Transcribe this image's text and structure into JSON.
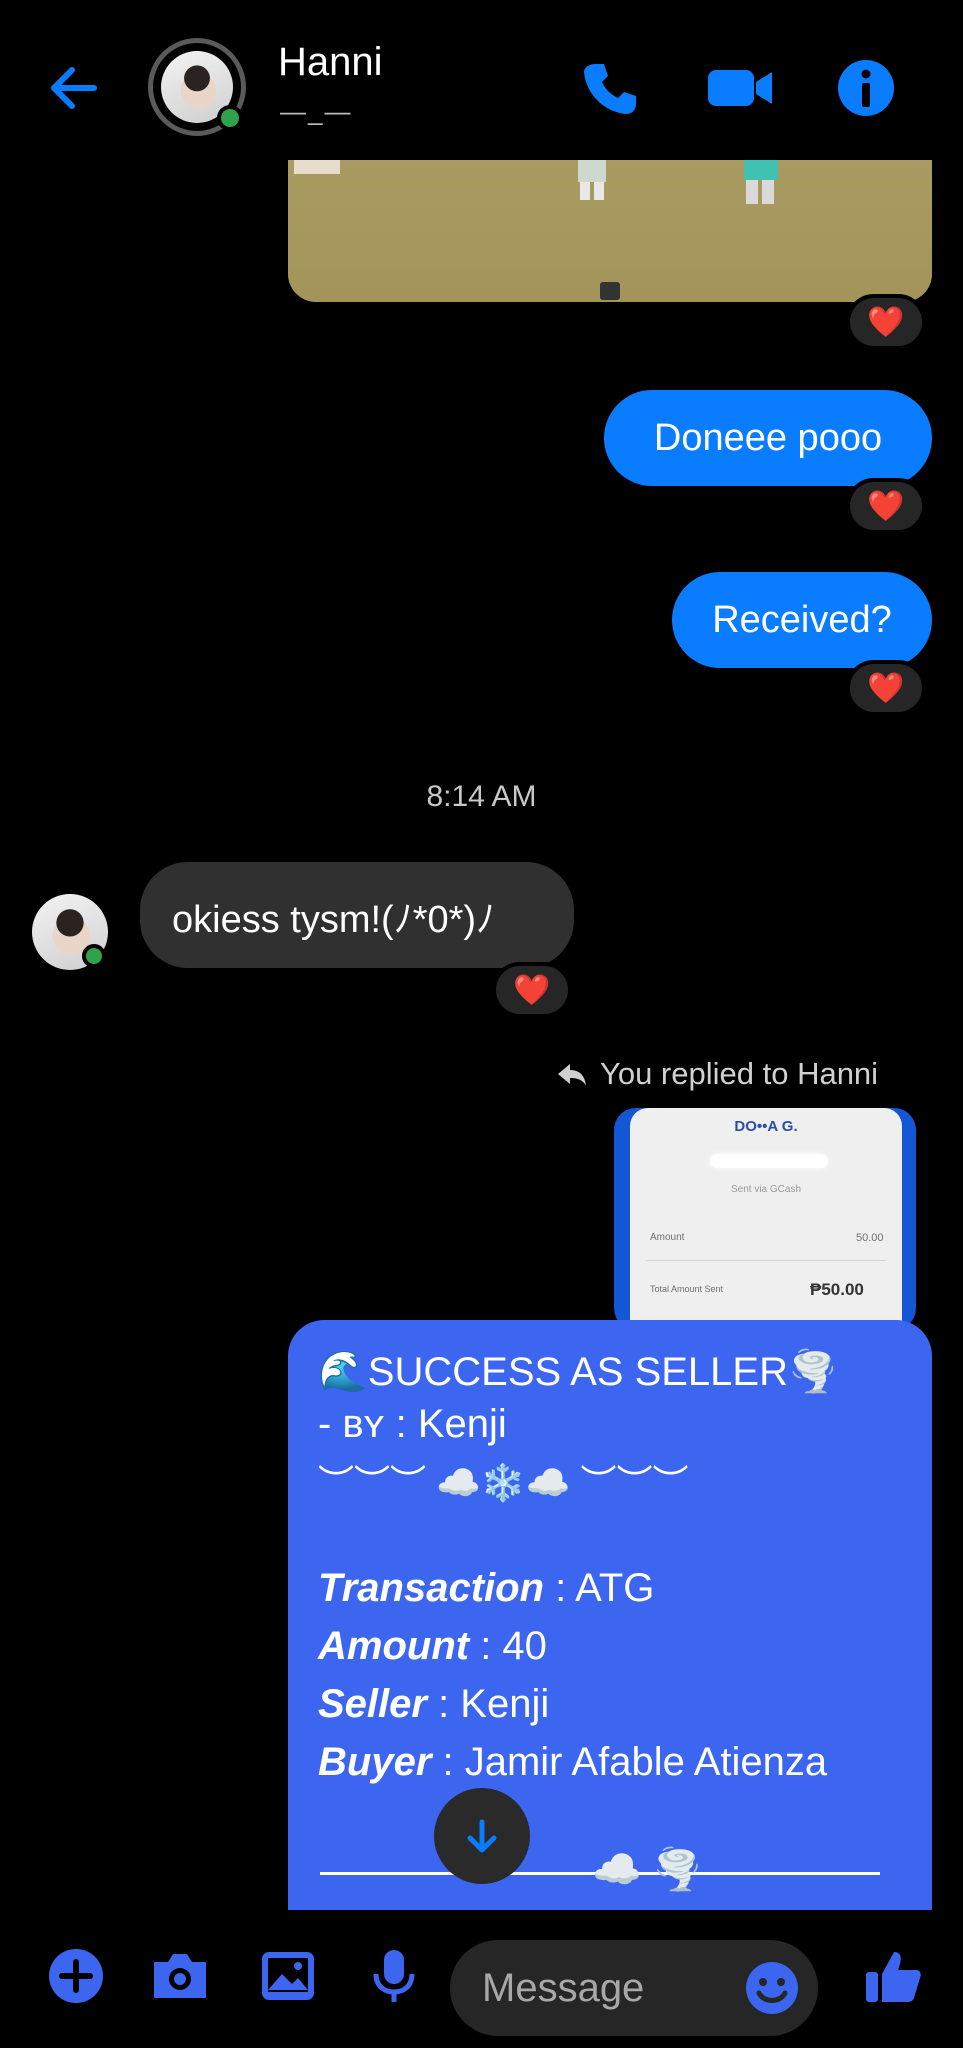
{
  "header": {
    "name": "Hanni",
    "subtitle": "—_—",
    "accent": "#0a7cff"
  },
  "messages": {
    "out1": "Doneee pooo",
    "out2": "Received?",
    "timestamp": "8:14 AM",
    "in1": "okiess tysm!(ﾉ*0*)ﾉ",
    "replied_label": "You replied to Hanni",
    "reaction": "❤️"
  },
  "receipt": {
    "name": "DO••A G.",
    "sent_via": "Sent via GCash",
    "amount_label": "Amount",
    "amount_value": "50.00",
    "total_label": "Total Amount Sent",
    "total_value": "₱50.00"
  },
  "card": {
    "title": "🌊SUCCESS AS SELLER🌪️",
    "by_prefix": "- ʙʏ : ",
    "by_name": "Kenji",
    "deco": "︶︶︶ ☁️❄️☁️ ︶︶︶",
    "transaction_label": "Transaction",
    "transaction_value": " : ATG",
    "amount_label": "Amount",
    "amount_value": " : 40",
    "seller_label": "Seller",
    "seller_value": " : Kenji",
    "buyer_label": "Buyer",
    "buyer_value": " : Jamir Afable Atienza",
    "footer_deco": "☁️ 🌪️"
  },
  "composer": {
    "placeholder": "Message"
  }
}
